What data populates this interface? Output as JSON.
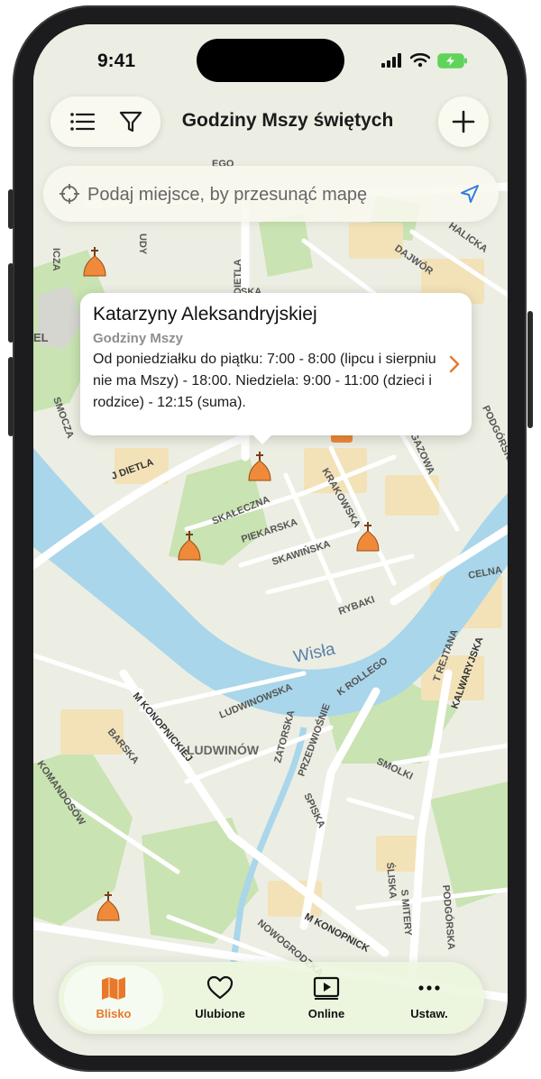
{
  "status_bar": {
    "time": "9:41"
  },
  "header": {
    "title": "Godziny Mszy świętych"
  },
  "search": {
    "placeholder": "Podaj miejsce, by przesunąć mapę"
  },
  "map": {
    "river_label": "Wisła",
    "district_label": "LUDWINÓW",
    "street_labels": [
      "J DIETLA",
      "DIETLA",
      "SKAŁECZNA",
      "PIEKARSKA",
      "SKAWIŃSKA",
      "KRAKOWSKA",
      "GAZOWA",
      "PODGÓRSKA",
      "DAJWÓR",
      "HALICKA",
      "SMOCZA",
      "RYBAKI",
      "CELNA",
      "KALWARYJSKA",
      "T REJTANA",
      "K ROLLEGO",
      "LUDWINOWSKA",
      "M KONOPNICKIEJ",
      "BARSKA",
      "KOMANDOSÓW",
      "ZATORSKA",
      "PRZEDWIOŚNIE",
      "SPISKA",
      "SMOLKI",
      "ŚLISKA",
      "S MITERY",
      "PODGÓRSKA",
      "NOWOGRODZKA",
      "M KONOPNICK",
      "EGO",
      "ICZA",
      "UDY",
      "SKA",
      "EL"
    ]
  },
  "callout": {
    "name": "Katarzyny Aleksandryjskiej",
    "subtitle": "Godziny Mszy",
    "hours": "Od poniedziałku do piątku: 7:00 - 8:00 (lipcu i sierpniu nie ma Mszy) - 18:00. Niedziela: 9:00 - 11:00 (dzieci i rodzice) - 12:15 (suma)."
  },
  "tabs": [
    {
      "label": "Blisko",
      "icon": "map-icon",
      "active": true
    },
    {
      "label": "Ulubione",
      "icon": "heart-icon",
      "active": false
    },
    {
      "label": "Online",
      "icon": "play-icon",
      "active": false
    },
    {
      "label": "Ustaw.",
      "icon": "more-icon",
      "active": false
    }
  ],
  "colors": {
    "accent": "#e8782a",
    "river": "#a9d6ea",
    "park": "#c7e2b0",
    "road": "#ffffff"
  }
}
